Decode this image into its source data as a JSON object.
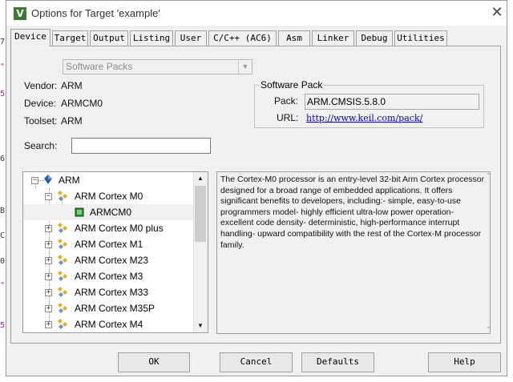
{
  "window": {
    "title": "Options for Target 'example'",
    "app_icon_letter": "V"
  },
  "background_gutter": [
    "7",
    "\"",
    "5",
    "6",
    "B",
    "C",
    "0",
    "\"",
    "5"
  ],
  "tabs": [
    {
      "label": "Device",
      "active": true
    },
    {
      "label": "Target"
    },
    {
      "label": "Output"
    },
    {
      "label": "Listing"
    },
    {
      "label": "User"
    },
    {
      "label": "C/C++ (AC6)"
    },
    {
      "label": "Asm"
    },
    {
      "label": "Linker"
    },
    {
      "label": "Debug"
    },
    {
      "label": "Utilities"
    }
  ],
  "source_select": {
    "value": "Software Packs"
  },
  "device_info": {
    "vendor_label": "Vendor:",
    "vendor": "ARM",
    "device_label": "Device:",
    "device": "ARMCM0",
    "toolset_label": "Toolset:",
    "toolset": "ARM",
    "search_label": "Search:",
    "search_value": ""
  },
  "software_pack": {
    "title": "Software Pack",
    "pack_label": "Pack:",
    "pack": "ARM.CMSIS.5.8.0",
    "url_label": "URL:",
    "url": "http://www.keil.com/pack/"
  },
  "tree": [
    {
      "label": "ARM",
      "expander": "−",
      "icon": "vendor-diamond-icon"
    },
    {
      "label": "ARM Cortex M0",
      "expander": "−",
      "icon": "device-family-icon"
    },
    {
      "label": "ARMCM0",
      "expander": "",
      "icon": "chip-icon",
      "selected": true
    },
    {
      "label": "ARM Cortex M0 plus",
      "expander": "+",
      "icon": "device-family-icon"
    },
    {
      "label": "ARM Cortex M1",
      "expander": "+",
      "icon": "device-family-icon"
    },
    {
      "label": "ARM Cortex M23",
      "expander": "+",
      "icon": "device-family-icon"
    },
    {
      "label": "ARM Cortex M3",
      "expander": "+",
      "icon": "device-family-icon"
    },
    {
      "label": "ARM Cortex M33",
      "expander": "+",
      "icon": "device-family-icon"
    },
    {
      "label": "ARM Cortex M35P",
      "expander": "+",
      "icon": "device-family-icon"
    },
    {
      "label": "ARM Cortex M4",
      "expander": "+",
      "icon": "device-family-icon"
    }
  ],
  "description": "The Cortex-M0 processor is an entry-level 32-bit Arm Cortex processor designed for a broad range of embedded applications. It offers significant benefits to developers, including:- simple, easy-to-use programmers model- highly efficient ultra-low power operation- excellent code density- deterministic, high-performance interrupt handling- upward compatibility with the rest of the Cortex-M processor family.",
  "buttons": {
    "ok": "OK",
    "cancel": "Cancel",
    "defaults": "Defaults",
    "help": "Help"
  },
  "colors": {
    "link": "#0000cc",
    "app_icon": "#3d7a34",
    "chip_icon": "#2e8b2e"
  }
}
